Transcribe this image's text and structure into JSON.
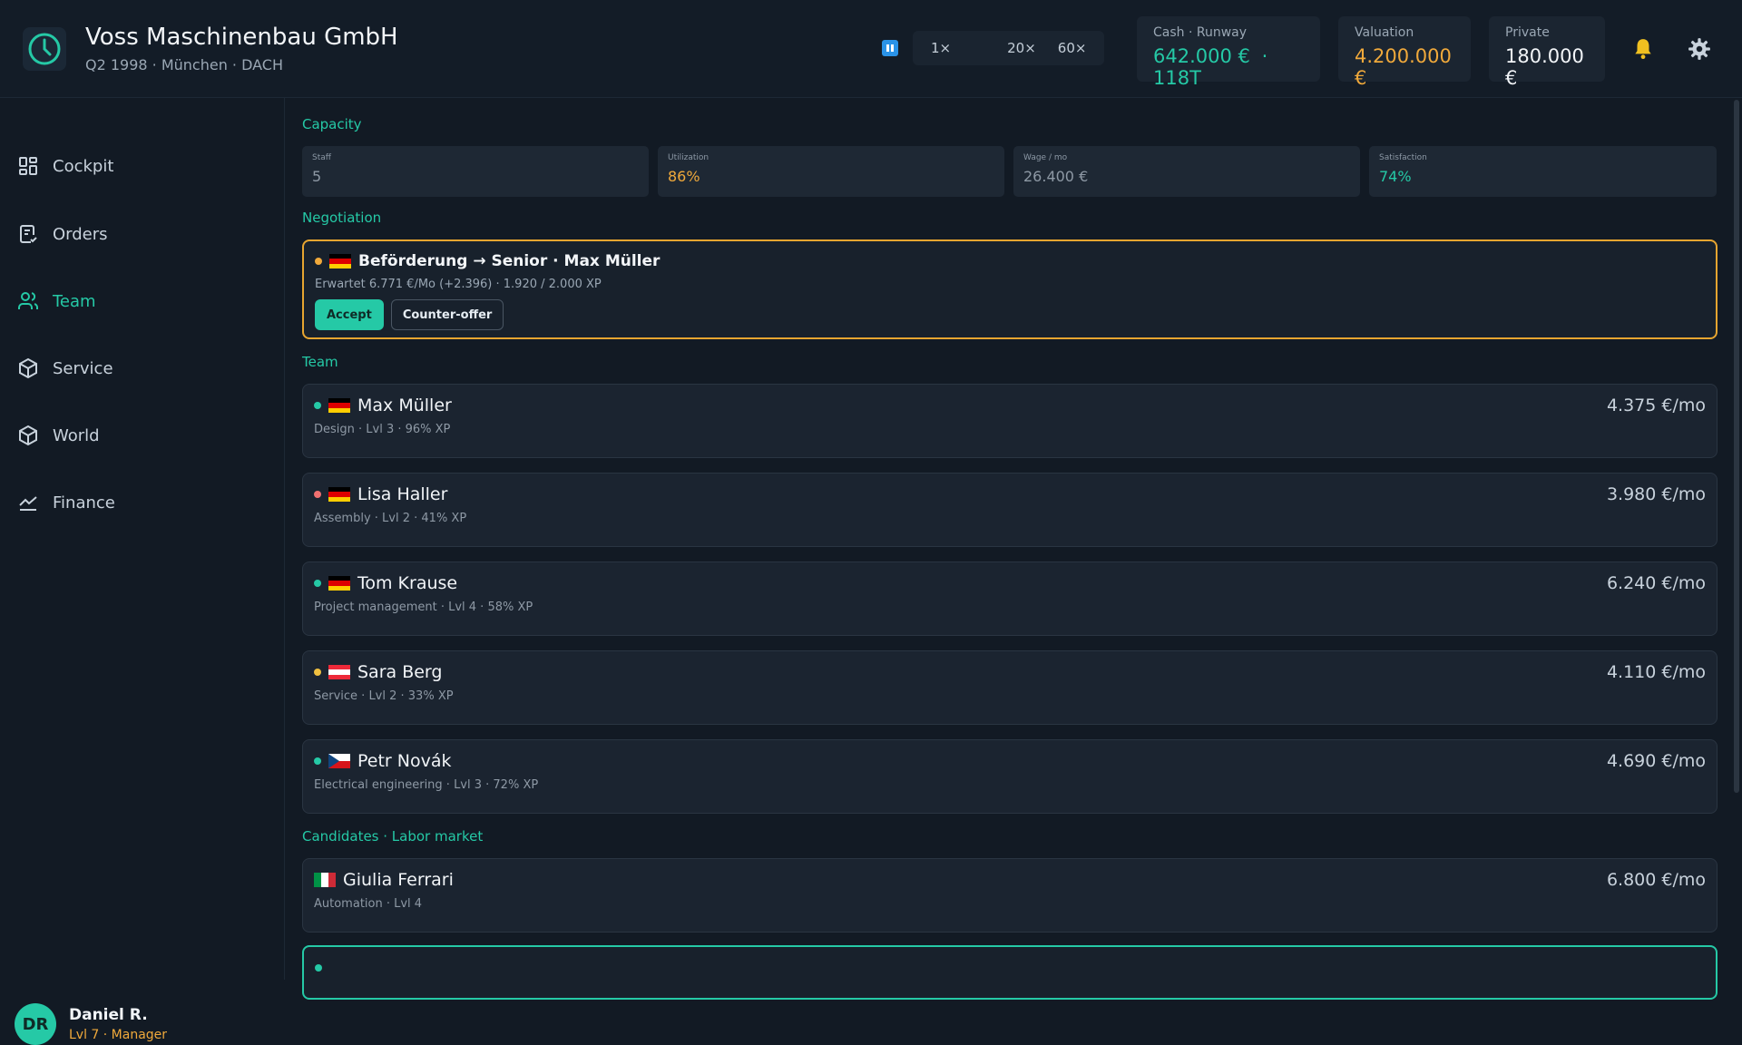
{
  "company": {
    "name": "Voss Maschinenbau GmbH",
    "meta": "Q2 1998 · München · DACH"
  },
  "speed": {
    "options": [
      "1×",
      "",
      "20×",
      "60×"
    ],
    "active_index": 1
  },
  "stats": {
    "cash_label": "Cash · Runway",
    "cash_value": "642.000 €",
    "runway_value": "118T",
    "valuation_label": "Valuation",
    "valuation_value": "4.200.000 €",
    "private_label": "Private",
    "private_value": "180.000 €"
  },
  "nav": {
    "items": [
      {
        "label": "Cockpit",
        "icon": "grid-icon"
      },
      {
        "label": "Orders",
        "icon": "clipboard-check-icon"
      },
      {
        "label": "Team",
        "icon": "users-icon"
      },
      {
        "label": "Service",
        "icon": "cube-icon"
      },
      {
        "label": "World",
        "icon": "cube-icon"
      },
      {
        "label": "Finance",
        "icon": "line-chart-icon"
      }
    ],
    "active": "Team"
  },
  "user": {
    "initials": "DR",
    "name": "Daniel R.",
    "level": "Lvl 7 · Manager"
  },
  "sections": {
    "capacity": "Capacity",
    "negotiation": "Negotiation",
    "team": "Team",
    "candidates": "Candidates · Labor market"
  },
  "capacity": {
    "staff_label": "Staff",
    "staff_value": "5",
    "utilization_label": "Utilization",
    "utilization_value": "86%",
    "wage_label": "Wage / mo",
    "wage_value": "26.400 €",
    "satisfaction_label": "Satisfaction",
    "satisfaction_value": "74%"
  },
  "negotiation": {
    "title": "Beförderung → Senior · Max Müller",
    "detail": "Erwartet 6.771 €/Mo (+2.396) · 1.920 / 2.000 XP",
    "accept_label": "Accept",
    "counter_label": "Counter-offer",
    "status_color": "#f0a93b",
    "flag": "de"
  },
  "team": [
    {
      "name": "Max Müller",
      "detail": "Design · Lvl 3 · 96% XP",
      "wage": "4.375 €/mo",
      "status_color": "#25c9a6",
      "flag": "de"
    },
    {
      "name": "Lisa Haller",
      "detail": "Assembly · Lvl 2 · 41% XP",
      "wage": "3.980 €/mo",
      "status_color": "#f07070",
      "flag": "de"
    },
    {
      "name": "Tom Krause",
      "detail": "Project management · Lvl 4 · 58% XP",
      "wage": "6.240 €/mo",
      "status_color": "#25c9a6",
      "flag": "de"
    },
    {
      "name": "Sara Berg",
      "detail": "Service · Lvl 2 · 33% XP",
      "wage": "4.110 €/mo",
      "status_color": "#f0c040",
      "flag": "at"
    },
    {
      "name": "Petr Novák",
      "detail": "Electrical engineering · Lvl 3 · 72% XP",
      "wage": "4.690 €/mo",
      "status_color": "#25c9a6",
      "flag": "cz"
    }
  ],
  "candidates": [
    {
      "name": "Giulia Ferrari",
      "detail": "Automation · Lvl 4",
      "wage": "6.800 €/mo",
      "flag": "it"
    }
  ],
  "colors": {
    "accent": "#25c9a6",
    "gold": "#f0a93b",
    "background": "#121a24"
  }
}
